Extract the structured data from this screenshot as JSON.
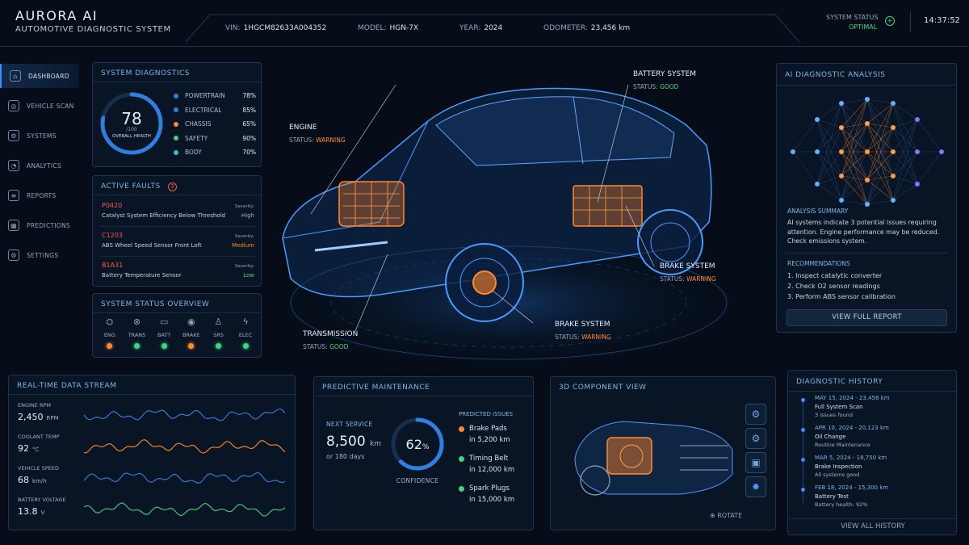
{
  "app": {
    "brand": "AURORA AI",
    "subtitle": "AUTOMOTIVE DIAGNOSTIC SYSTEM"
  },
  "vehicle": {
    "vin_label": "VIN:",
    "vin": "1HGCM82633A004352",
    "model_label": "MODEL:",
    "model": "HGN-7X",
    "year_label": "YEAR:",
    "year": "2024",
    "odo_label": "ODOMETER:",
    "odo": "23,456 km"
  },
  "status": {
    "label": "SYSTEM STATUS",
    "value": "OPTIMAL",
    "time": "14:37:52"
  },
  "nav": [
    {
      "label": "DASHBOARD",
      "icon": "home-icon",
      "active": true
    },
    {
      "label": "VEHICLE SCAN",
      "icon": "scan-icon"
    },
    {
      "label": "SYSTEMS",
      "icon": "gear-icon"
    },
    {
      "label": "ANALYTICS",
      "icon": "analytics-icon"
    },
    {
      "label": "REPORTS",
      "icon": "reports-icon"
    },
    {
      "label": "PREDICTIONS",
      "icon": "predictions-icon"
    },
    {
      "label": "SETTINGS",
      "icon": "settings-icon"
    }
  ],
  "diagnostics": {
    "title": "SYSTEM DIAGNOSTICS",
    "score": "78",
    "score_max": "/100",
    "score_label": "OVERALL HEALTH",
    "score_frac": 0.78,
    "items": [
      {
        "label": "POWERTRAIN",
        "value": "78%",
        "color": "#2f7fe0"
      },
      {
        "label": "ELECTRICAL",
        "value": "85%",
        "color": "#2f7fe0"
      },
      {
        "label": "CHASSIS",
        "value": "65%",
        "color": "#ff8a2a"
      },
      {
        "label": "SAFETY",
        "value": "90%",
        "color": "#3fd67a"
      },
      {
        "label": "BODY",
        "value": "70%",
        "color": "#2fb8e0"
      }
    ]
  },
  "faults": {
    "title": "ACTIVE FAULTS",
    "count": "3",
    "severity_label": "Severity:",
    "items": [
      {
        "code": "P0420",
        "desc": "Catalyst System Efficiency Below Threshold",
        "severity": "High",
        "sev_color": "#9fb6cc"
      },
      {
        "code": "C1203",
        "desc": "ABS Wheel Speed Sensor Front Left",
        "severity": "Medium",
        "sev_color": "#ff8a2a"
      },
      {
        "code": "B1A31",
        "desc": "Battery Temperature Sensor",
        "severity": "Low",
        "sev_color": "#3fd67a"
      }
    ]
  },
  "overview": {
    "title": "SYSTEM STATUS OVERVIEW",
    "items": [
      {
        "label": "ENG",
        "icon": "engine-icon",
        "color": "#ff8a2a"
      },
      {
        "label": "TRANS",
        "icon": "transmission-icon",
        "color": "#3fd67a"
      },
      {
        "label": "BATT",
        "icon": "battery-icon",
        "color": "#3fd67a"
      },
      {
        "label": "BRAKE",
        "icon": "brake-icon",
        "color": "#ff8a2a"
      },
      {
        "label": "SRS",
        "icon": "airbag-icon",
        "color": "#3fd67a"
      },
      {
        "label": "ELEC",
        "icon": "lightning-icon",
        "color": "#3fd67a"
      }
    ]
  },
  "callouts": {
    "engine": {
      "label": "ENGINE",
      "status_label": "STATUS:",
      "status": "WARNING"
    },
    "battery": {
      "label": "BATTERY SYSTEM",
      "status_label": "STATUS:",
      "status": "GOOD"
    },
    "brake_rear": {
      "label": "BRAKE SYSTEM",
      "status_label": "STATUS:",
      "status": "WARNING"
    },
    "brake_front": {
      "label": "BRAKE SYSTEM",
      "status_label": "STATUS:",
      "status": "WARNING"
    },
    "transmission": {
      "label": "TRANSMISSION",
      "status_label": "STATUS:",
      "status": "GOOD"
    }
  },
  "ai": {
    "title": "AI DIAGNOSTIC ANALYSIS",
    "summary_title": "ANALYSIS SUMMARY",
    "summary": "AI systems indicate 3 potential issues requiring attention. Engine performance may be reduced. Check emissions system.",
    "rec_title": "RECOMMENDATIONS",
    "recs": [
      "1.  Inspect catalytic converter",
      "2.  Check O2 sensor readings",
      "3.  Perform ABS sensor calibration"
    ],
    "button": "VIEW FULL REPORT"
  },
  "stream": {
    "title": "REAL-TIME DATA STREAM",
    "items": [
      {
        "label": "ENGINE RPM",
        "value": "2,450",
        "unit": "RPM",
        "color": "#3a7fe0"
      },
      {
        "label": "COOLANT TEMP",
        "value": "92",
        "unit": "°C",
        "color": "#ff8a2a"
      },
      {
        "label": "VEHICLE SPEED",
        "value": "68",
        "unit": "km/h",
        "color": "#3a7fe0"
      },
      {
        "label": "BATTERY VOLTAGE",
        "value": "13.8",
        "unit": "V",
        "color": "#3fd67a"
      }
    ]
  },
  "predictive": {
    "title": "PREDICTIVE MAINTENANCE",
    "next_label": "NEXT SERVICE",
    "next_value": "8,500",
    "next_unit": "km",
    "next_alt": "or 180 days",
    "confidence": "62",
    "confidence_unit": "%",
    "confidence_label": "CONFIDENCE",
    "confidence_frac": 0.62,
    "issues_title": "PREDICTED ISSUES",
    "issues": [
      {
        "name": "Brake Pads",
        "eta": "in 5,200 km",
        "color": "#ff8a2a"
      },
      {
        "name": "Timing Belt",
        "eta": "in 12,000 km",
        "color": "#3fd67a"
      },
      {
        "name": "Spark Plugs",
        "eta": "in 15,000 km",
        "color": "#3fd67a"
      }
    ]
  },
  "component": {
    "title": "3D COMPONENT VIEW",
    "rotate": "ROTATE"
  },
  "history": {
    "title": "DIAGNOSTIC HISTORY",
    "items": [
      {
        "date": "MAY 15, 2024 - 23,456 km",
        "title": "Full System Scan",
        "detail": "3 issues found"
      },
      {
        "date": "APR 10, 2024 - 20,123 km",
        "title": "Oil Change",
        "detail": "Routine Maintenance"
      },
      {
        "date": "MAR 5, 2024 - 18,750 km",
        "title": "Brake Inspection",
        "detail": "All systems good"
      },
      {
        "date": "FEB 18, 2024 - 15,300 km",
        "title": "Battery Test",
        "detail": "Battery health: 92%"
      }
    ],
    "button": "VIEW ALL HISTORY"
  }
}
